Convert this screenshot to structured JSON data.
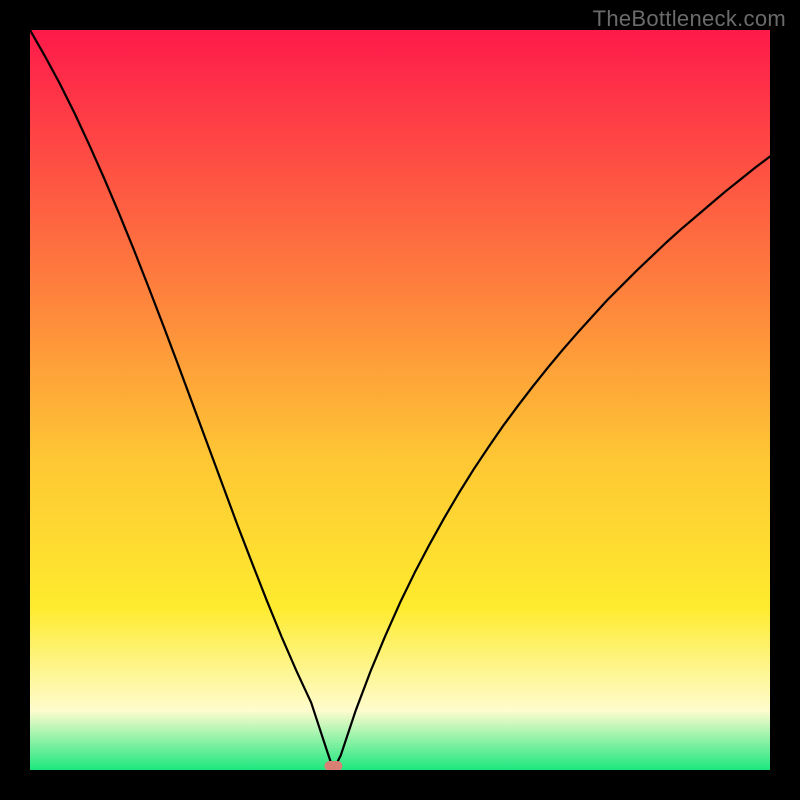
{
  "watermark": "TheBottleneck.com",
  "colors": {
    "gradient_top": "#fe1a4a",
    "gradient_mid_upper": "#fe7a3e",
    "gradient_mid": "#fec734",
    "gradient_mid_lower": "#feeb2e",
    "gradient_light": "#fefcce",
    "gradient_bottom": "#1ce77e",
    "frame": "#000000",
    "curve_stroke": "#000000",
    "marker_fill": "#d88074"
  },
  "chart_data": {
    "type": "line",
    "title": "",
    "xlabel": "",
    "ylabel": "",
    "xlim": [
      0,
      100
    ],
    "ylim": [
      0,
      100
    ],
    "grid": false,
    "annotations": [
      "TheBottleneck.com"
    ],
    "minimum_marker": {
      "x": 41,
      "y": 0
    },
    "x": [
      0,
      2,
      4,
      6,
      8,
      10,
      12,
      14,
      16,
      18,
      20,
      22,
      24,
      26,
      28,
      30,
      32,
      34,
      36,
      38,
      40,
      41,
      42,
      44,
      46,
      48,
      50,
      52,
      54,
      56,
      58,
      60,
      62,
      64,
      66,
      68,
      70,
      72,
      74,
      76,
      78,
      80,
      82,
      84,
      86,
      88,
      90,
      92,
      94,
      96,
      98,
      100
    ],
    "y": [
      100,
      96.5,
      92.8,
      88.8,
      84.5,
      80.0,
      75.3,
      70.4,
      65.3,
      60.1,
      54.8,
      49.4,
      44.0,
      38.6,
      33.2,
      28.0,
      22.9,
      18.0,
      13.4,
      9.1,
      3.0,
      0.0,
      2.0,
      8.0,
      13.3,
      18.1,
      22.6,
      26.7,
      30.5,
      34.1,
      37.5,
      40.7,
      43.7,
      46.6,
      49.3,
      51.9,
      54.4,
      56.8,
      59.1,
      61.3,
      63.5,
      65.5,
      67.5,
      69.4,
      71.3,
      73.1,
      74.8,
      76.5,
      78.2,
      79.8,
      81.4,
      82.9
    ]
  }
}
